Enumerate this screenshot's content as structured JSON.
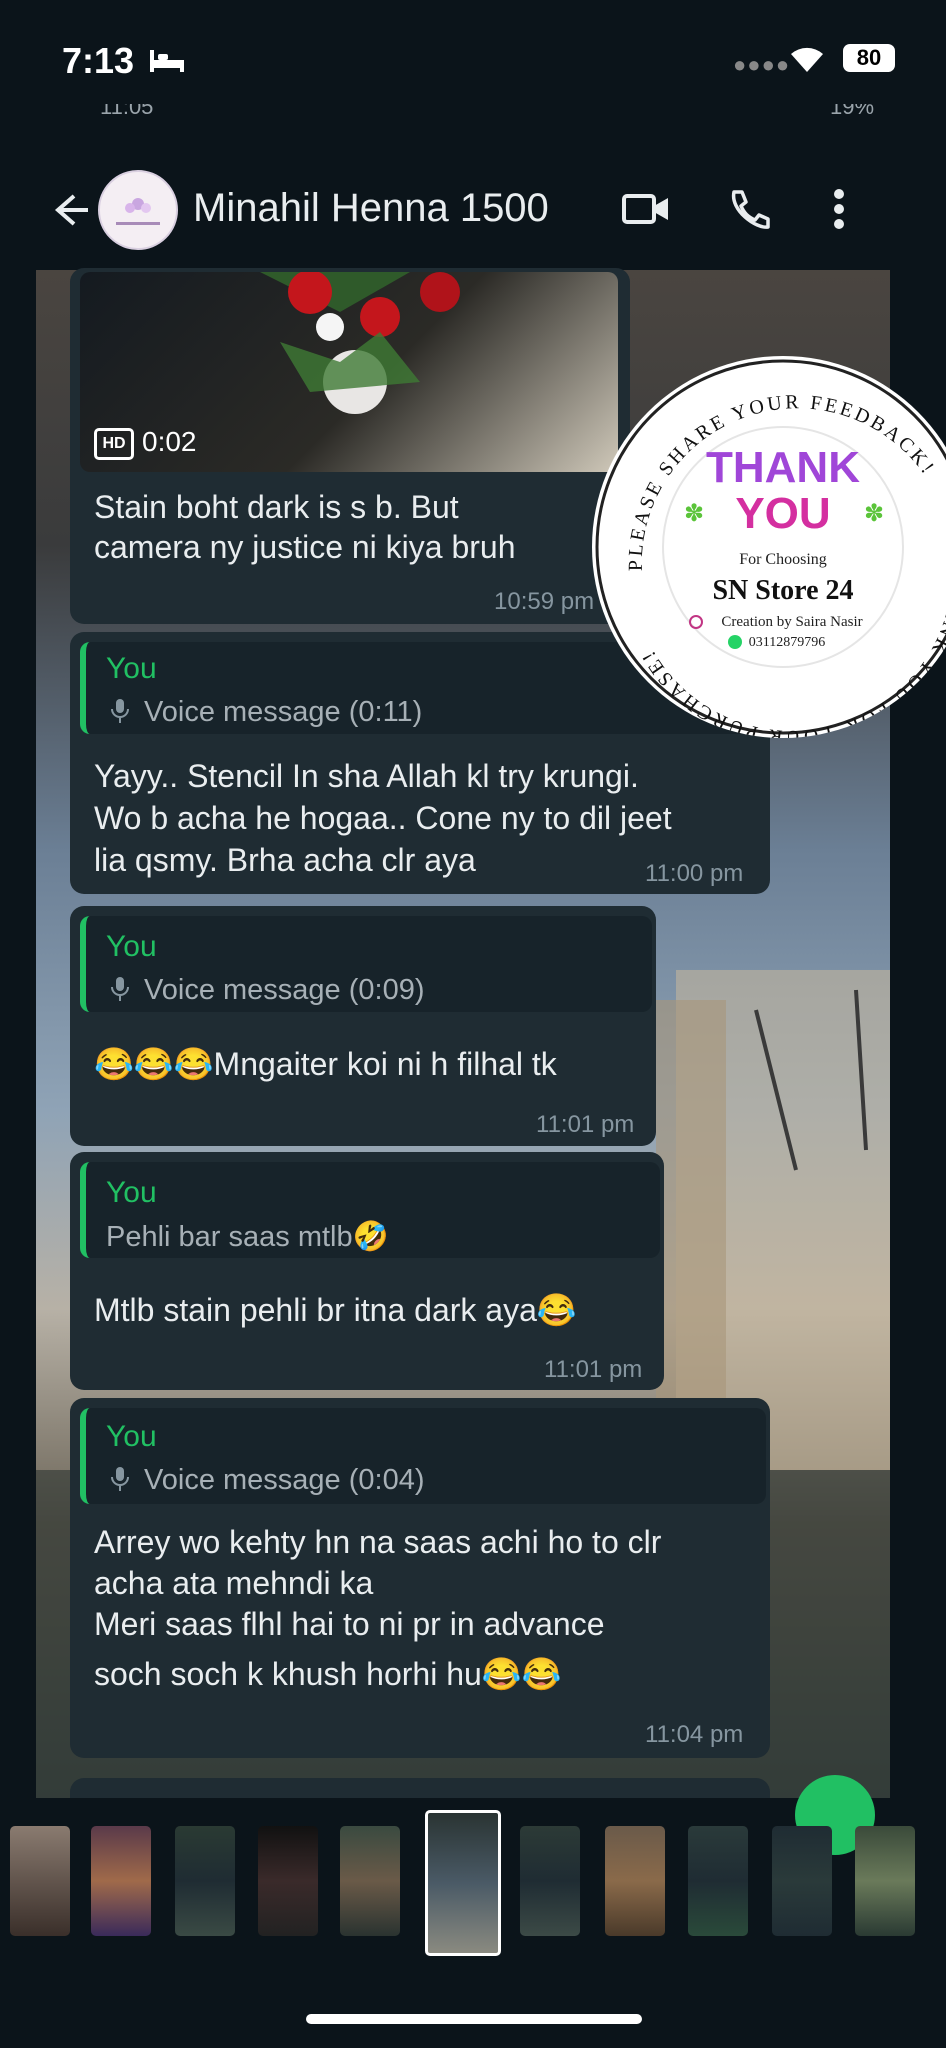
{
  "status_bar": {
    "time": "7:13",
    "battery": "80"
  },
  "inner_status": {
    "time": "11:05",
    "battery": "19%"
  },
  "header": {
    "contact_name": "Minahil Henna 1500"
  },
  "video": {
    "hd": "HD",
    "duration": "0:02"
  },
  "messages": [
    {
      "text_lines": [
        "Stain boht dark is s b. But",
        "camera ny justice ni kiya bruh"
      ],
      "time": "10:59 pm"
    },
    {
      "quote_name": "You",
      "quote_text": "Voice message (0:11)",
      "text_lines": [
        "Yayy.. Stencil In sha Allah kl try krungi.",
        "Wo b acha he hogaa.. Cone ny to dil jeet",
        "lia qsmy. Brha acha clr aya"
      ],
      "time": "11:00 pm"
    },
    {
      "quote_name": "You",
      "quote_text": "Voice message (0:09)",
      "text_lines": [
        "😂😂😂Mngaiter koi ni h filhal tk"
      ],
      "time": "11:01 pm"
    },
    {
      "quote_name": "You",
      "quote_text": "Pehli bar saas mtlb🤣",
      "text_lines": [
        "Mtlb stain pehli br itna dark aya😂"
      ],
      "time": "11:01 pm"
    },
    {
      "quote_name": "You",
      "quote_text": "Voice message (0:04)",
      "text_lines": [
        "Arrey wo kehty hn na saas achi ho to clr",
        "acha ata mehndi ka",
        "Meri saas flhl hai to ni pr in advance",
        "soch soch k khush horhi hu😂😂"
      ],
      "time": "11:04 pm"
    }
  ],
  "sticker": {
    "ring_top": "PLEASE SHARE YOUR FEEDBACK!",
    "ring_bottom": "THANK YOU FOR YOUR PURCHASE!",
    "thank": "THANK",
    "you": "YOU",
    "for_choosing": "For Choosing",
    "store": "SN Store 24",
    "creator": "Creation by Saira Nasir",
    "phone": "03112879796"
  },
  "colors": {
    "accent": "#21c063",
    "bubble": "#1f2c33",
    "background": "#0b141a"
  }
}
